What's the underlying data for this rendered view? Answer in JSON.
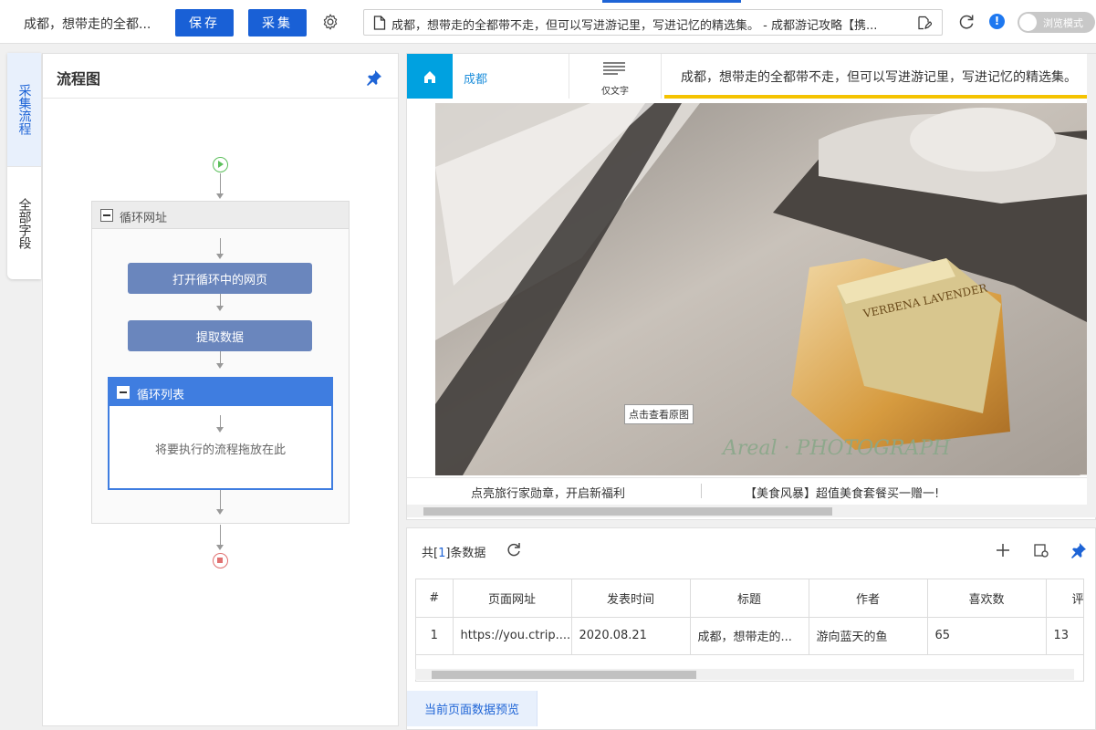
{
  "topbar": {
    "title": "成都，想带走的全都...",
    "save_label": "保存",
    "collect_label": "采集",
    "url_text": "成都，想带走的全都带不走，但可以写进游记里，写进记忆的精选集。 - 成都游记攻略【携...",
    "info_badge": "!",
    "browse_mode_label": "浏览模式"
  },
  "side_tabs": [
    {
      "label": "采集流程"
    },
    {
      "label": "全部字段"
    }
  ],
  "flow_panel": {
    "title": "流程图",
    "loop_url_label": "循环网址",
    "step_open_label": "打开循环中的网页",
    "step_extract_label": "提取数据",
    "loop_list_label": "循环列表",
    "drop_hint": "将要执行的流程拖放在此"
  },
  "browser": {
    "breadcrumb": "成都",
    "text_only_label": "仅文字",
    "page_title": "成都，想带走的全都带不走，但可以写进游记里，写进记忆的精选集。",
    "photo_tooltip": "点击查看原图",
    "watermark": "Areal · PHOTOGRAPH",
    "ad_left": "点亮旅行家勋章，开启新福利",
    "ad_right": "【美食风暴】超值美食套餐买一赠一!",
    "soap_brand": "VERBENA LAVENDER"
  },
  "data_panel": {
    "count_prefix": "共[",
    "count_value": "1",
    "count_suffix": "]条数据",
    "preview_label": "当前页面数据预览",
    "columns": [
      "#",
      "页面网址",
      "发表时间",
      "标题",
      "作者",
      "喜欢数",
      "评"
    ],
    "rows": [
      [
        "1",
        "https://you.ctrip....",
        "2020.08.21",
        "成都，想带走的...",
        "游向蓝天的鱼",
        "65",
        "13"
      ]
    ]
  },
  "colors": {
    "primary": "#1960d6",
    "step": "#6a86bd",
    "home_tab": "#00a1e0",
    "title_underline": "#f5c300"
  }
}
